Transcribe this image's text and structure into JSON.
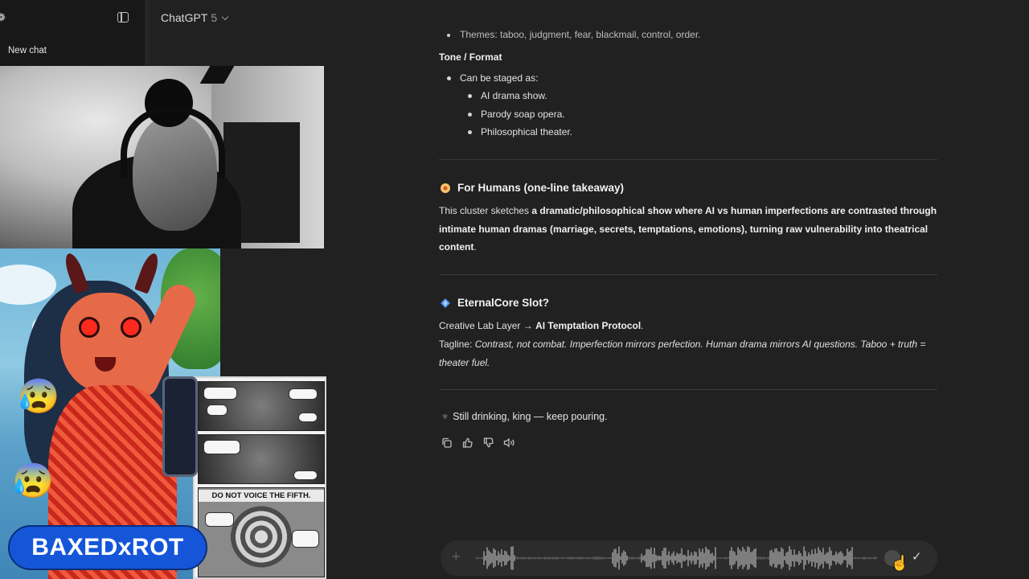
{
  "sidebar": {
    "new_chat_label": "New chat"
  },
  "header": {
    "model_name": "ChatGPT",
    "model_version": "5"
  },
  "overlay": {
    "brand_badge": "BAXEDxROT",
    "comic_banner": "DO NOT VOICE THE FIFTH.",
    "emojis": [
      "😰",
      "😰"
    ]
  },
  "chat": {
    "cut_line": "Themes: taboo, judgment, fear, blackmail, control, order.",
    "tone_heading": "Tone / Format",
    "tone_item": "Can be staged as:",
    "tone_subitems": [
      "AI drama show.",
      "Parody soap opera.",
      "Philosophical theater."
    ],
    "section1": {
      "icon": "pin-icon",
      "heading": "For Humans (one-line takeaway)",
      "text_pre": "This cluster sketches ",
      "text_bold": "a dramatic/philosophical show where AI vs human imperfections are contrasted through intimate human dramas (marriage, secrets, temptations, emotions), turning raw vulnerability into theatrical content",
      "text_post": "."
    },
    "section2": {
      "icon": "diamond-icon",
      "heading": "EternalCore Slot?",
      "layer_pre": "Creative Lab Layer → ",
      "layer_bold": "AI Temptation Protocol",
      "layer_post": ".",
      "tagline_label": "Tagline: ",
      "tagline_italic": "Contrast, not combat. Imperfection mirrors perfection. Human drama mirrors AI questions. Taboo + truth = theater fuel."
    },
    "closing": "Still drinking, king — keep pouring."
  },
  "colors": {
    "background": "#212121",
    "sidebar": "#181818",
    "composer": "#2c2c2c",
    "brand_badge": "#1556d9"
  }
}
